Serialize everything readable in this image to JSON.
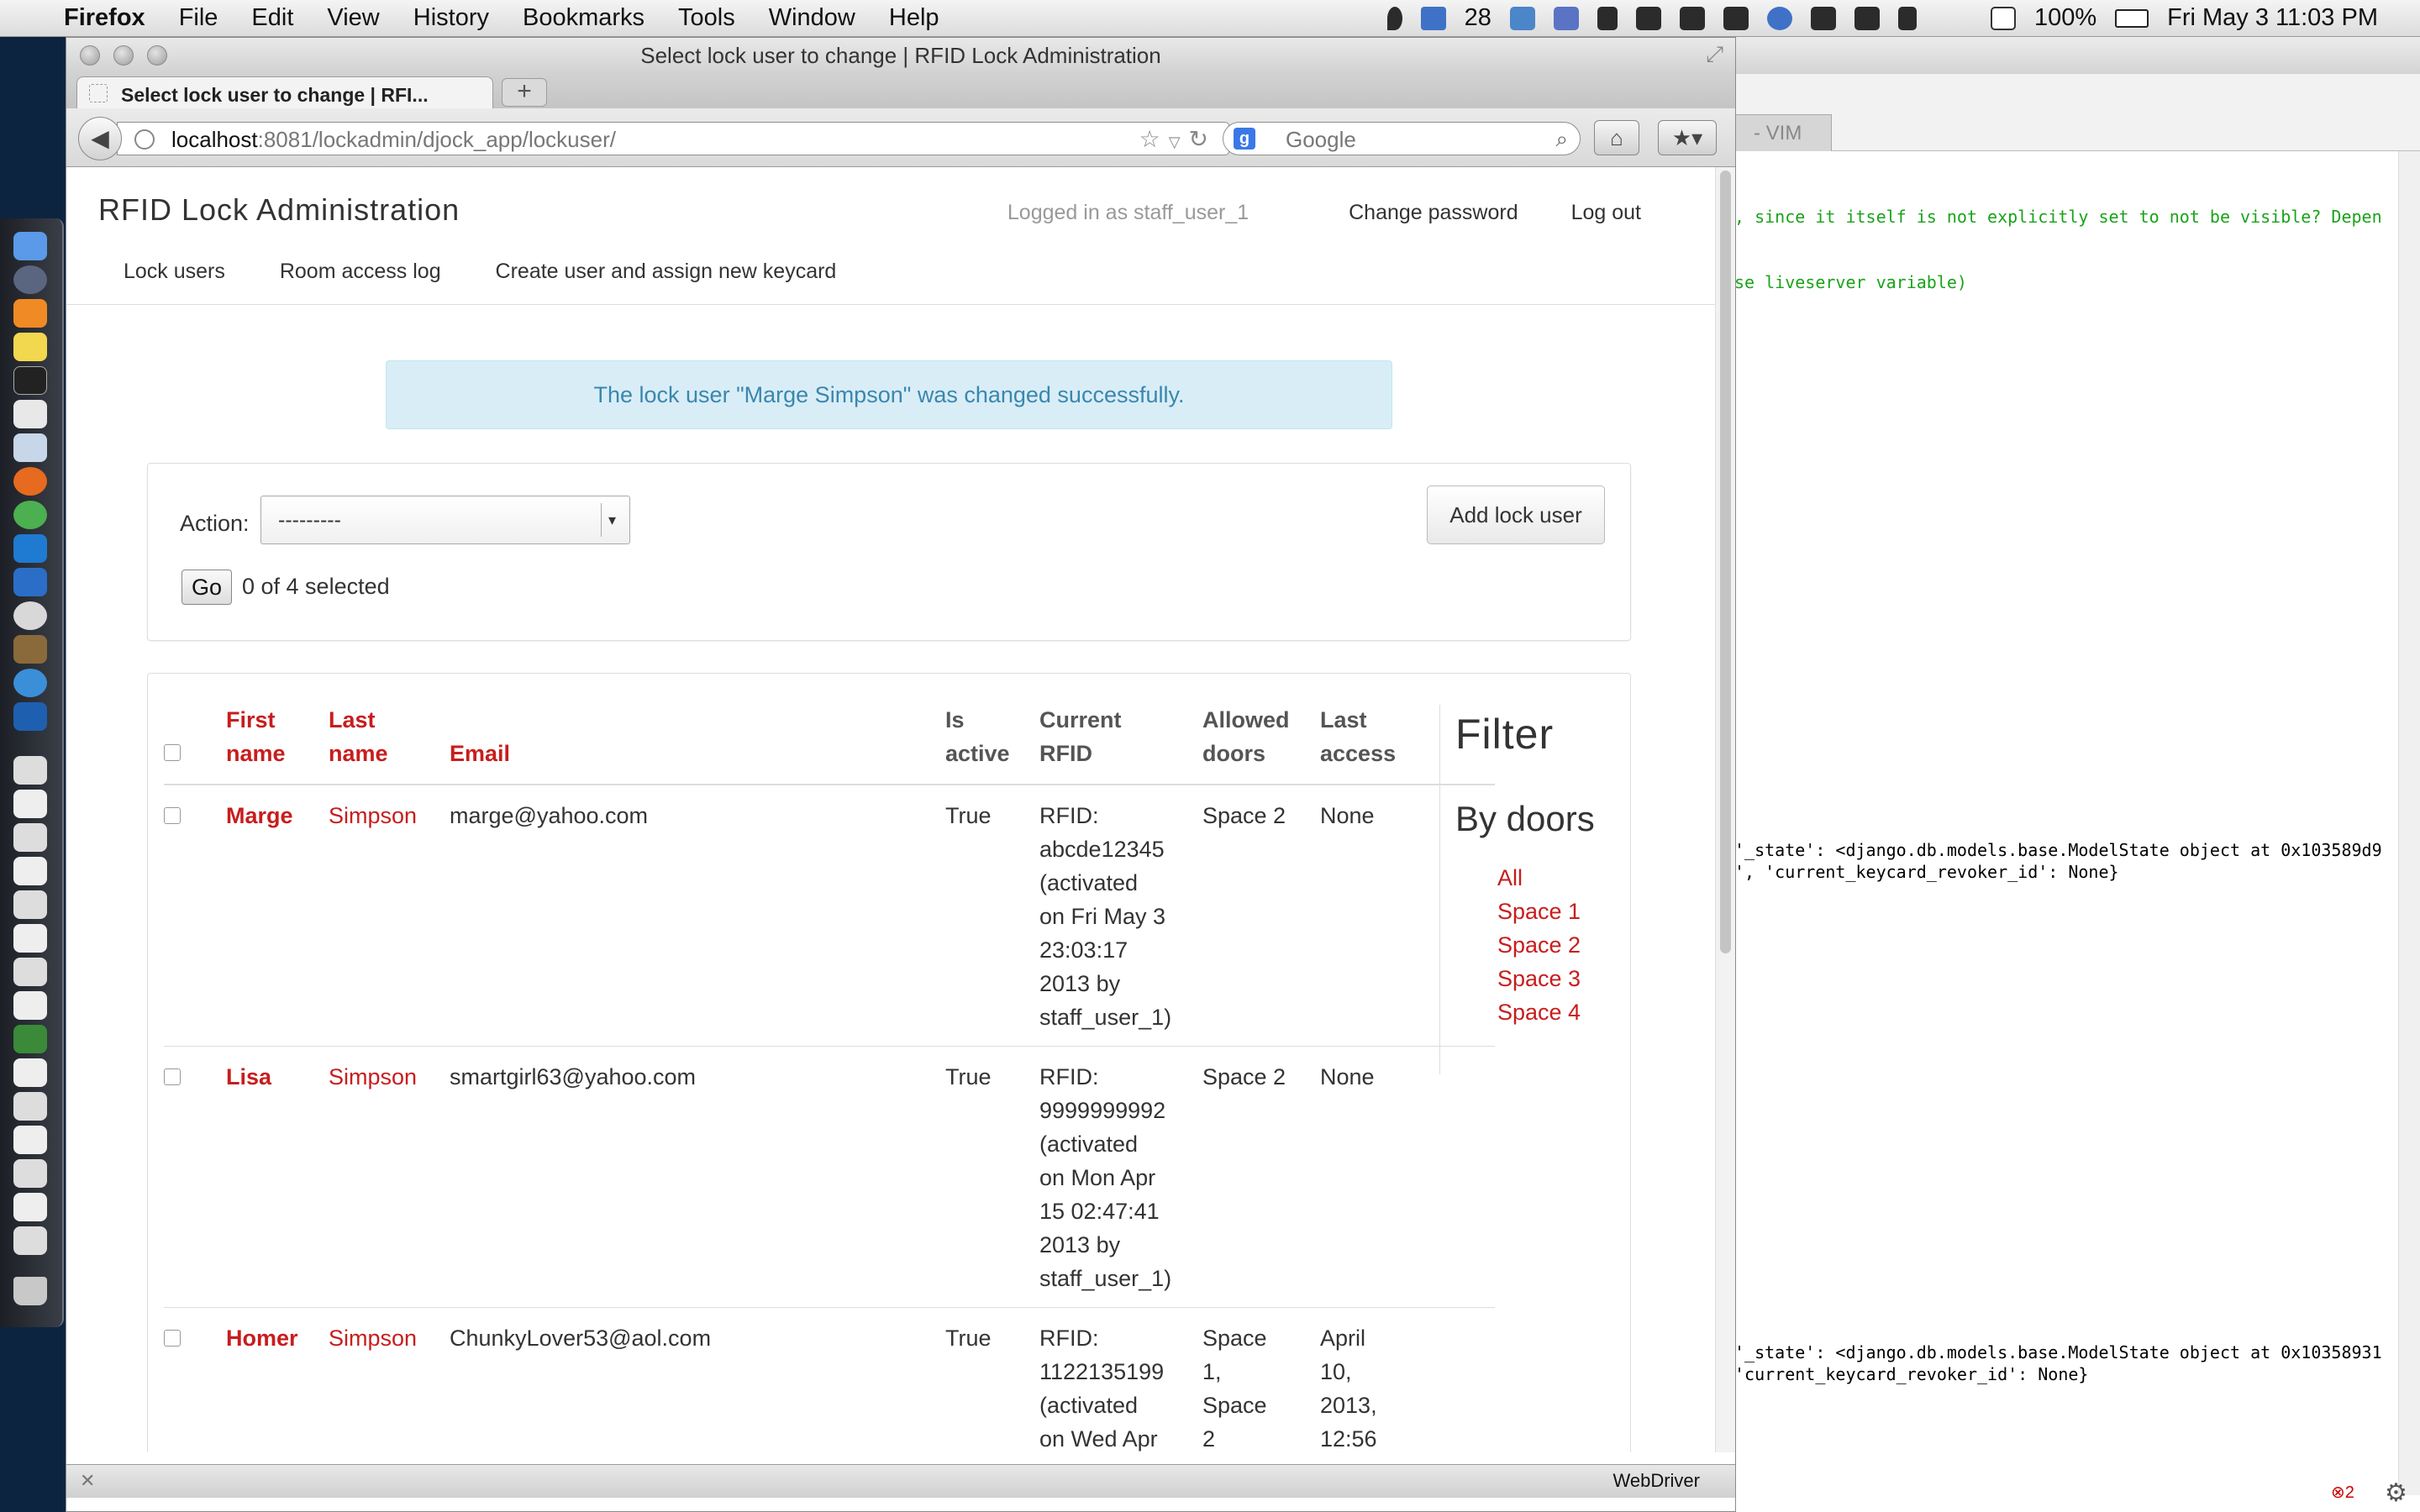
{
  "menubar": {
    "app": "Firefox",
    "items": [
      "File",
      "Edit",
      "View",
      "History",
      "Bookmarks",
      "Tools",
      "Window",
      "Help"
    ],
    "badge_count": "28",
    "battery": "100%",
    "clock": "Fri May 3  11:03 PM"
  },
  "vim": {
    "tab_label": "- VIM",
    "lines": {
      "l1": ", since it itself is not explicitly set to not be visible? Depen",
      "l2": "se liveserver variable)",
      "l3": "'_state': <django.db.models.base.ModelState object at 0x103589d9",
      "l4": "', 'current_keycard_revoker_id': None}",
      "l5": "'_state': <django.db.models.base.ModelState object at 0x10358931",
      "l6": "'current_keycard_revoker_id': None}"
    },
    "error_count": "2"
  },
  "browser": {
    "window_title": "Select lock user to change | RFID Lock Administration",
    "tab_title": "Select lock user to change | RFI...",
    "url_host": "localhost",
    "url_rest": ":8081/lockadmin/djock_app/lockuser/",
    "search_placeholder": "Google",
    "status_text": "WebDriver"
  },
  "site": {
    "title": "RFID Lock Administration",
    "logged_in_as": "Logged in as staff_user_1",
    "change_password": "Change password",
    "log_out": "Log out",
    "nav": {
      "lock_users": "Lock users",
      "room_access_log": "Room access log",
      "create_user": "Create user and assign new keycard"
    }
  },
  "message": "The lock user \"Marge Simpson\" was changed successfully.",
  "actions": {
    "label": "Action:",
    "selected_option": "---------",
    "go": "Go",
    "selected_count": "0 of 4 selected",
    "add_button": "Add lock user"
  },
  "table": {
    "headers": {
      "first_name": [
        "First",
        "name"
      ],
      "last_name": [
        "Last",
        "name"
      ],
      "email": "Email",
      "is_active": [
        "Is",
        "active"
      ],
      "current_rfid": [
        "Current",
        "RFID"
      ],
      "allowed_doors": [
        "Allowed",
        "doors"
      ],
      "last_access": [
        "Last",
        "access"
      ]
    },
    "rows": [
      {
        "first": "Marge",
        "last": "Simpson",
        "email": "marge@yahoo.com",
        "active": "True",
        "rfid": [
          "RFID:",
          "abcde12345",
          "(activated",
          "on Fri May 3",
          "23:03:17",
          "2013 by",
          "staff_user_1)"
        ],
        "doors": [
          "Space 2"
        ],
        "last_access": [
          "None"
        ]
      },
      {
        "first": "Lisa",
        "last": "Simpson",
        "email": "smartgirl63@yahoo.com",
        "active": "True",
        "rfid": [
          "RFID:",
          "9999999992",
          "(activated",
          "on Mon Apr",
          "15 02:47:41",
          "2013 by",
          "staff_user_1)"
        ],
        "doors": [
          "Space 2"
        ],
        "last_access": [
          "None"
        ]
      },
      {
        "first": "Homer",
        "last": "Simpson",
        "email": "ChunkyLover53@aol.com",
        "active": "True",
        "rfid": [
          "RFID:",
          "1122135199",
          "(activated",
          "on Wed Apr"
        ],
        "doors": [
          "Space",
          "1,",
          "Space",
          "2"
        ],
        "last_access": [
          "April",
          "10,",
          "2013,",
          "12:56"
        ]
      }
    ]
  },
  "filter": {
    "title": "Filter",
    "subtitle": "By doors",
    "options": [
      "All",
      "Space 1",
      "Space 2",
      "Space 3",
      "Space 4"
    ]
  },
  "colors": {
    "link_red": "#c81d1d",
    "info_bg": "#d9edf7",
    "info_text": "#3a87ad",
    "vim_green": "#1aa31a"
  }
}
